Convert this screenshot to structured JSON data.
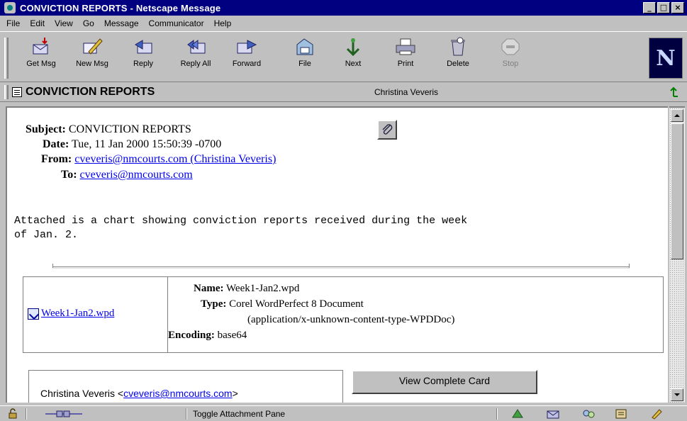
{
  "window": {
    "title": "CONVICTION REPORTS - Netscape Message",
    "minimize_glyph": "_",
    "maximize_glyph": "□",
    "close_glyph": "×"
  },
  "menu": [
    "File",
    "Edit",
    "View",
    "Go",
    "Message",
    "Communicator",
    "Help"
  ],
  "toolbar": {
    "buttons": [
      {
        "label": "Get Msg",
        "icon": "get-msg-icon",
        "enabled": true
      },
      {
        "label": "New Msg",
        "icon": "new-msg-icon",
        "enabled": true
      },
      {
        "label": "Reply",
        "icon": "reply-icon",
        "enabled": true
      },
      {
        "label": "Reply All",
        "icon": "reply-all-icon",
        "enabled": true
      },
      {
        "label": "Forward",
        "icon": "forward-icon",
        "enabled": true
      },
      {
        "label": "File",
        "icon": "file-icon",
        "enabled": true
      },
      {
        "label": "Next",
        "icon": "next-icon",
        "enabled": true
      },
      {
        "label": "Print",
        "icon": "print-icon",
        "enabled": true
      },
      {
        "label": "Delete",
        "icon": "delete-icon",
        "enabled": true
      },
      {
        "label": "Stop",
        "icon": "stop-icon",
        "enabled": false
      }
    ],
    "logo_letter": "N"
  },
  "location": {
    "title": "CONVICTION REPORTS",
    "sender": "Christina Veveris"
  },
  "message": {
    "subject_label": "Subject:",
    "subject": "CONVICTION REPORTS",
    "date_label": "Date:",
    "date": "Tue, 11 Jan 2000 15:50:39 -0700",
    "from_label": "From:",
    "from": "cveveris@nmcourts.com (Christina Veveris)",
    "to_label": "To:",
    "to": "cveveris@nmcourts.com",
    "body": "Attached is a chart showing conviction reports received during the week\nof Jan. 2."
  },
  "attachment": {
    "file_link": "Week1-Jan2.wpd",
    "name_label": "Name:",
    "name": "Week1-Jan2.wpd",
    "type_label": "Type:",
    "type": "Corel WordPerfect 8 Document",
    "type_detail": "(application/x-unknown-content-type-WPDDoc)",
    "encoding_label": "Encoding:",
    "encoding": "base64"
  },
  "card": {
    "name_prefix": "Christina Veveris <",
    "email": "cveveris@nmcourts.com",
    "name_suffix": ">",
    "view_button": "View Complete Card"
  },
  "status": {
    "text": "Toggle Attachment Pane"
  }
}
